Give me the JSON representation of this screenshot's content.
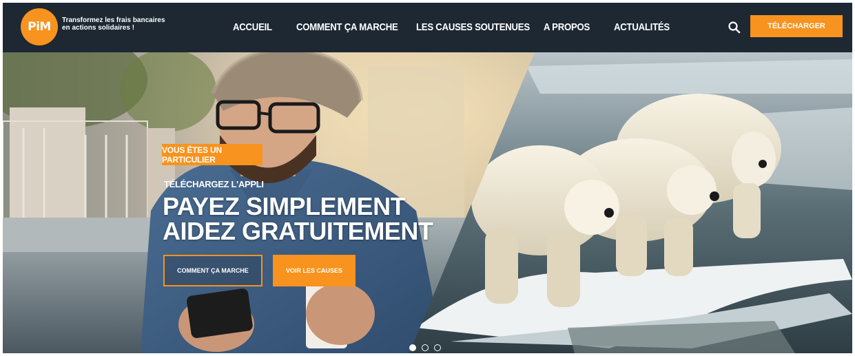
{
  "brand": {
    "logo_text": "PiM",
    "tagline_line1": "Transformez les frais bancaires",
    "tagline_line2": "en actions solidaires !"
  },
  "nav": {
    "items": [
      "ACCUEIL",
      "COMMENT ÇA MARCHE",
      "LES CAUSES SOUTENUES",
      "A PROPOS",
      "ACTUALITÉS"
    ],
    "cta_label": "TÉLÉCHARGER"
  },
  "hero": {
    "badge": "VOUS ÊTES UN PARTICULIER",
    "subtitle": "TÉLÉCHARGEZ L'APPLI",
    "headline_line1": "PAYEZ SIMPLEMENT",
    "headline_line2": "AIDEZ GRATUITEMENT",
    "button_how": "COMMENT ÇA MARCHE",
    "button_causes": "VOIR LES CAUSES",
    "slides_total": 3,
    "slide_active": 1
  },
  "colors": {
    "accent": "#f7931e",
    "nav_bg": "#1d2833"
  },
  "icons": [
    "search-icon"
  ]
}
